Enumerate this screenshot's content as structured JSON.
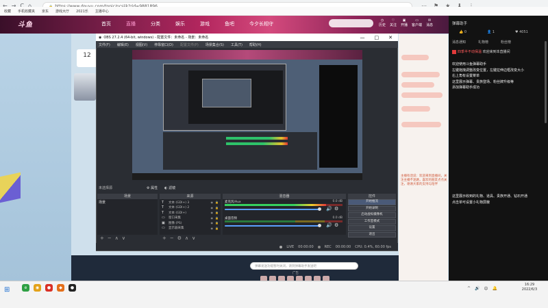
{
  "browser": {
    "url": "https://www.douyu.com/topic/ncsjjk?rid=9881896",
    "nav_back": "←",
    "nav_forward": "→",
    "nav_reload": "C",
    "nav_home": "⌂",
    "lock": "🔒",
    "bookmarks": [
      "收藏",
      "手机收藏夹",
      "京东",
      "游戏大厅",
      "2021乐",
      "主播中心"
    ],
    "right_icons": [
      "⋯",
      "⚑",
      "★",
      "⬇",
      "⋮"
    ]
  },
  "douyu": {
    "logo": "斗鱼",
    "nav_items": [
      "首页",
      "直播",
      "分类",
      "娱乐",
      "游戏",
      "鱼吧",
      "今夕长相守"
    ],
    "active_nav": "直播",
    "head_icons": [
      "历史",
      "关注",
      "开播",
      "客户端",
      "消息"
    ],
    "counter": "12",
    "bottom_input_placeholder": "弹幕发送功能暂时关闭，请到弹幕助手发送吧",
    "ad_label": "广告",
    "right_chat_text": "主播有话说：欢迎来到直播间，关注主播不迷路，喜欢的朋友点点关注，谢谢大家的支持与陪伴"
  },
  "side_panel": {
    "title": "弹幕助手",
    "stats": [
      "0",
      "1",
      "4051"
    ],
    "tabs": [
      "消息通知",
      "礼物榜",
      "粉丝榜"
    ],
    "msg_user": "四季半不动保温",
    "msg_welcome": "欢迎来到本直播间",
    "block1": [
      "欢迎使用斗鱼弹幕助手",
      "左键拖拽调整改变位置，左键拉伸边框改变大小",
      "右上角有设置菜单",
      "这里展示弹幕、贵族登场、粉丝牌升级等",
      "添加弹幕助手成功"
    ],
    "block2": [
      "这里展示收到的礼物、道具、贵族开通、钻石开通",
      "点击单可设置小礼物屏蔽"
    ]
  },
  "obs": {
    "title": "OBS 27.2.4 (64-bit, windows) - 配置文件：未命名 - 场景：未命名",
    "window_ctrls": [
      "—",
      "□",
      "✕"
    ],
    "menu": [
      "文件(F)",
      "编辑(E)",
      "视图(V)",
      "停靠窗口(D)",
      "配置文件(P)",
      "场景集合(S)",
      "工具(T)",
      "帮助(H)"
    ],
    "no_source": "未选择源",
    "props_label": "属性",
    "filters_label": "滤镜",
    "panels": {
      "scenes": "场景",
      "sources": "来源",
      "mixer": "混音器",
      "transitions": "转场",
      "controls": "控件"
    },
    "scene_items": [
      "场景"
    ],
    "sources": [
      {
        "type": "T",
        "name": "文本 (GDI+) 3"
      },
      {
        "type": "T",
        "name": "文本 (GDI+) 2"
      },
      {
        "type": "T",
        "name": "文本 (GDI+)"
      },
      {
        "type": "▭",
        "name": "窗口采集"
      },
      {
        "type": "▣",
        "name": "图像 (PS)"
      },
      {
        "type": "▭",
        "name": "显示器采集"
      }
    ],
    "mixer": [
      {
        "name": "麦克风/Aux",
        "db": "0.0 dB",
        "level": 0.86
      },
      {
        "name": "桌面音频",
        "db": "0.0 dB",
        "level": 0.0
      }
    ],
    "controls": [
      "开始推流",
      "开始录制",
      "启动虚拟摄像机",
      "工作室模式",
      "设置",
      "退出"
    ],
    "highlighted_control": "开始推流",
    "foot_icons": [
      "+",
      "−",
      "⚙",
      "∧",
      "∨"
    ],
    "status": {
      "lte": "LIVE",
      "live_time": "00:00:00",
      "rec": "REC",
      "rec_time": "00:00:00",
      "cpu": "CPU: 0.4%, 60.00 fps"
    }
  },
  "taskbar": {
    "start": "⊞",
    "apps": [
      {
        "label": "e",
        "color": "#2ea043"
      },
      {
        "label": "◉",
        "color": "#e3a21a"
      },
      {
        "label": "●",
        "color": "#d93025"
      },
      {
        "label": "◆",
        "color": "#e46f1a"
      },
      {
        "label": "●",
        "color": "#222222"
      }
    ],
    "tray": [
      "^",
      "🔊",
      "中",
      "🔔"
    ],
    "time": "16:29",
    "date": "2022/6/3"
  }
}
